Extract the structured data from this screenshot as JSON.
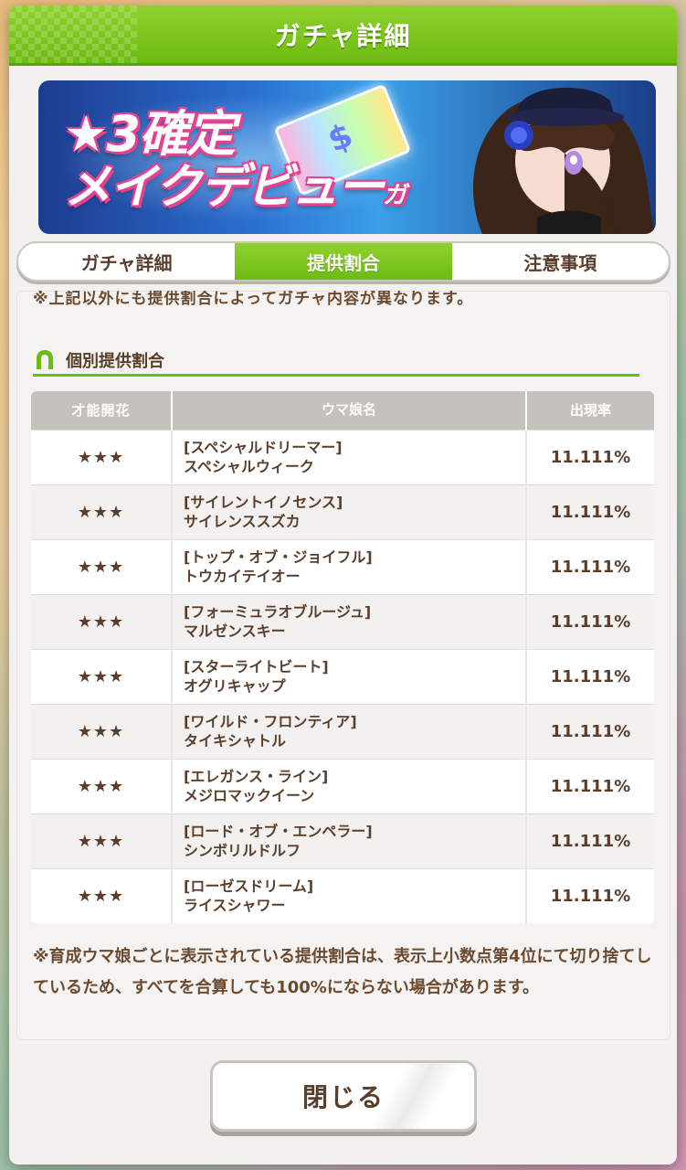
{
  "dialog": {
    "title": "ガチャ詳細",
    "banner": {
      "line1": "★3確定",
      "line2": "メイクデビュー",
      "line2_suffix": "ガチャ"
    },
    "tabs": [
      {
        "label": "ガチャ詳細",
        "active": false
      },
      {
        "label": "提供割合",
        "active": true
      },
      {
        "label": "注意事項",
        "active": false
      }
    ],
    "cut_text": "※上記以外にも提供割合によってガチャ内容が異なります。",
    "section_title": "個別提供割合",
    "table": {
      "headers": [
        "才能開花",
        "ウマ娘名",
        "出現率"
      ],
      "rows": [
        {
          "rarity": "★★★",
          "title": "[スペシャルドリーマー]",
          "name": "スペシャルウィーク",
          "rate": "11.111%"
        },
        {
          "rarity": "★★★",
          "title": "[サイレントイノセンス]",
          "name": "サイレンススズカ",
          "rate": "11.111%"
        },
        {
          "rarity": "★★★",
          "title": "[トップ・オブ・ジョイフル]",
          "name": "トウカイテイオー",
          "rate": "11.111%"
        },
        {
          "rarity": "★★★",
          "title": "[フォーミュラオブルージュ]",
          "name": "マルゼンスキー",
          "rate": "11.111%"
        },
        {
          "rarity": "★★★",
          "title": "[スターライトビート]",
          "name": "オグリキャップ",
          "rate": "11.111%"
        },
        {
          "rarity": "★★★",
          "title": "[ワイルド・フロンティア]",
          "name": "タイキシャトル",
          "rate": "11.111%"
        },
        {
          "rarity": "★★★",
          "title": "[エレガンス・ライン]",
          "name": "メジロマックイーン",
          "rate": "11.111%"
        },
        {
          "rarity": "★★★",
          "title": "[ロード・オブ・エンペラー]",
          "name": "シンボリルドルフ",
          "rate": "11.111%"
        },
        {
          "rarity": "★★★",
          "title": "[ローゼスドリーム]",
          "name": "ライスシャワー",
          "rate": "11.111%"
        }
      ]
    },
    "note": "※育成ウマ娘ごとに表示されている提供割合は、表示上小数点第4位にて切り捨てしているため、すべてを合算しても100%にならない場合があります。",
    "close_label": "閉じる"
  },
  "colors": {
    "accent_green": "#6dbb12",
    "text_brown": "#5a3e2b",
    "header_gray": "#c5c1bc"
  },
  "icons": {
    "section": "horseshoe-icon"
  }
}
